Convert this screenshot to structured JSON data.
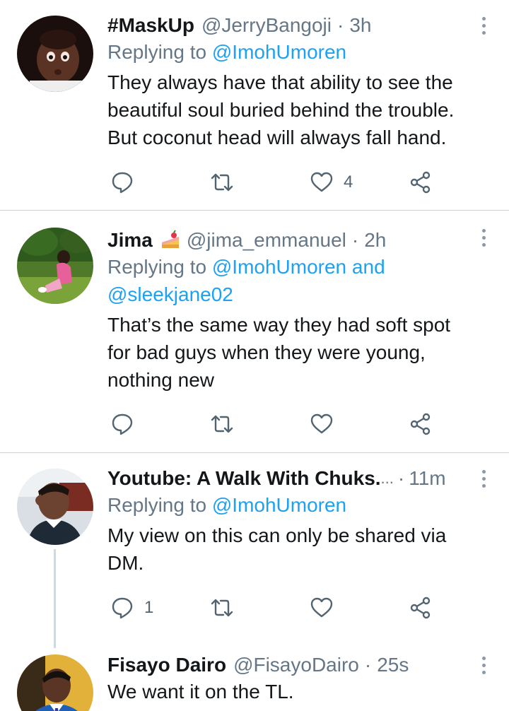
{
  "tweets": [
    {
      "name": "#MaskUp",
      "handle": "@JerryBangoji",
      "dot": "·",
      "time": "3h",
      "replying_prefix": "Replying to ",
      "replying_to": "@ImohUmoren",
      "replying_and": "",
      "replying_to_2": "",
      "body": [
        "They always have that ability to see the",
        "beautiful soul buried behind the trouble.",
        "But coconut head will always fall hand."
      ],
      "reply_count": "",
      "retweet_count": "",
      "like_count": "4"
    },
    {
      "name": "Jima",
      "name_emoji": "cake-emoji",
      "handle": "@jima_emmanuel",
      "dot": "·",
      "time": "2h",
      "replying_prefix": "Replying to ",
      "replying_to": "@ImohUmoren",
      "replying_and": " and",
      "replying_to_2": "@sleekjane02",
      "body": [
        "That’s the same way they had soft spot",
        "for bad guys when they were young,",
        "nothing new"
      ],
      "reply_count": "",
      "retweet_count": "",
      "like_count": ""
    },
    {
      "name": "Youtube: A Walk With Chuks.",
      "ellipsis": " ...",
      "dot": "·",
      "time": "11m",
      "replying_prefix": "Replying to ",
      "replying_to": "@ImohUmoren",
      "body": [
        "My view on this can only be shared via",
        "DM."
      ],
      "reply_count": "1",
      "retweet_count": "",
      "like_count": ""
    },
    {
      "name": "Fisayo Dairo",
      "handle": "@FisayoDairo",
      "dot": "·",
      "time": "25s",
      "body": [
        "We want it on the TL."
      ]
    }
  ],
  "icons": {
    "reply": "reply-icon",
    "retweet": "retweet-icon",
    "like": "like-icon",
    "share": "share-icon",
    "more": "more-icon"
  },
  "colors": {
    "text": "#14171a",
    "secondary": "#657786",
    "mention": "#1da1f2",
    "divider": "#d0d0d0",
    "icon": "#536471"
  }
}
